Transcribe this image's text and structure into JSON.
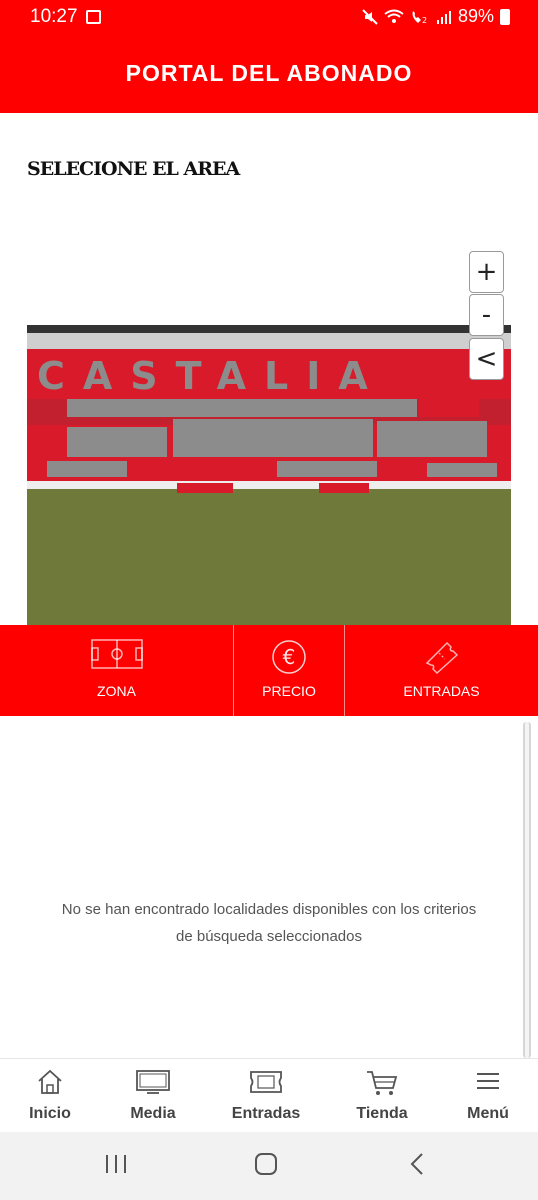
{
  "status_bar": {
    "time": "10:27",
    "battery": "89%",
    "icons": [
      "gallery-icon",
      "mute-icon",
      "wifi-icon",
      "wifi-call-icon",
      "signal-icon",
      "battery-icon"
    ]
  },
  "header": {
    "title": "PORTAL DEL ABONADO"
  },
  "section": {
    "title": "SELECIONE EL AREA"
  },
  "map_controls": {
    "zoom_in": "+",
    "zoom_out": "-",
    "back": "<"
  },
  "stadium": {
    "stand_lettering": "CASTALIA"
  },
  "filter_tabs": [
    {
      "label": "ZONA",
      "icon": "field-icon"
    },
    {
      "label": "PRECIO",
      "icon": "euro-icon"
    },
    {
      "label": "ENTRADAS",
      "icon": "ticket-icon"
    }
  ],
  "empty_message": "No se han encontrado localidades disponibles con los criterios de búsqueda seleccionados",
  "bottom_nav": [
    {
      "label": "Inicio",
      "icon": "home-icon"
    },
    {
      "label": "Media",
      "icon": "tv-icon"
    },
    {
      "label": "Entradas",
      "icon": "ticket-icon"
    },
    {
      "label": "Tienda",
      "icon": "cart-icon"
    },
    {
      "label": "Menú",
      "icon": "menu-icon"
    }
  ],
  "colors": {
    "brand_red": "#ff0000",
    "seat_red": "#d91a2a",
    "pitch_green": "#6f7a3a",
    "stand_gray": "#8c8c8c"
  }
}
